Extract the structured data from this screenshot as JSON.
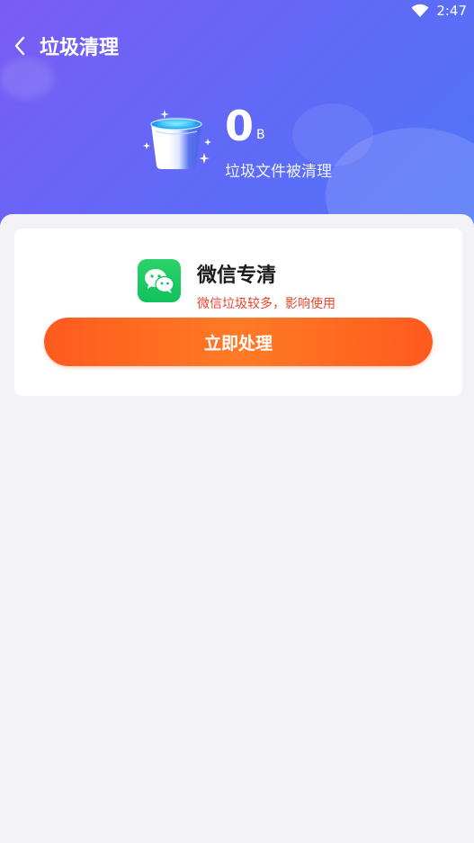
{
  "status_bar": {
    "time": "2:47"
  },
  "header": {
    "title": "垃圾清理",
    "cleaned_size_value": "0",
    "cleaned_size_unit": "B",
    "subtitle": "垃圾文件被清理"
  },
  "wechat_card": {
    "app_name": "微信专清",
    "warning": "微信垃圾较多，影响使用",
    "action_label": "立即处理"
  },
  "colors": {
    "header_gradient_start": "#7b5cf5",
    "header_gradient_end": "#4f78f7",
    "action_button": "#ff6e22",
    "warning_text": "#e8452e",
    "wechat_green": "#12c15b"
  },
  "icons": {
    "back": "chevron-left-icon",
    "wifi": "wifi-icon",
    "trash_bin": "trash-bin-icon",
    "wechat": "wechat-icon"
  }
}
